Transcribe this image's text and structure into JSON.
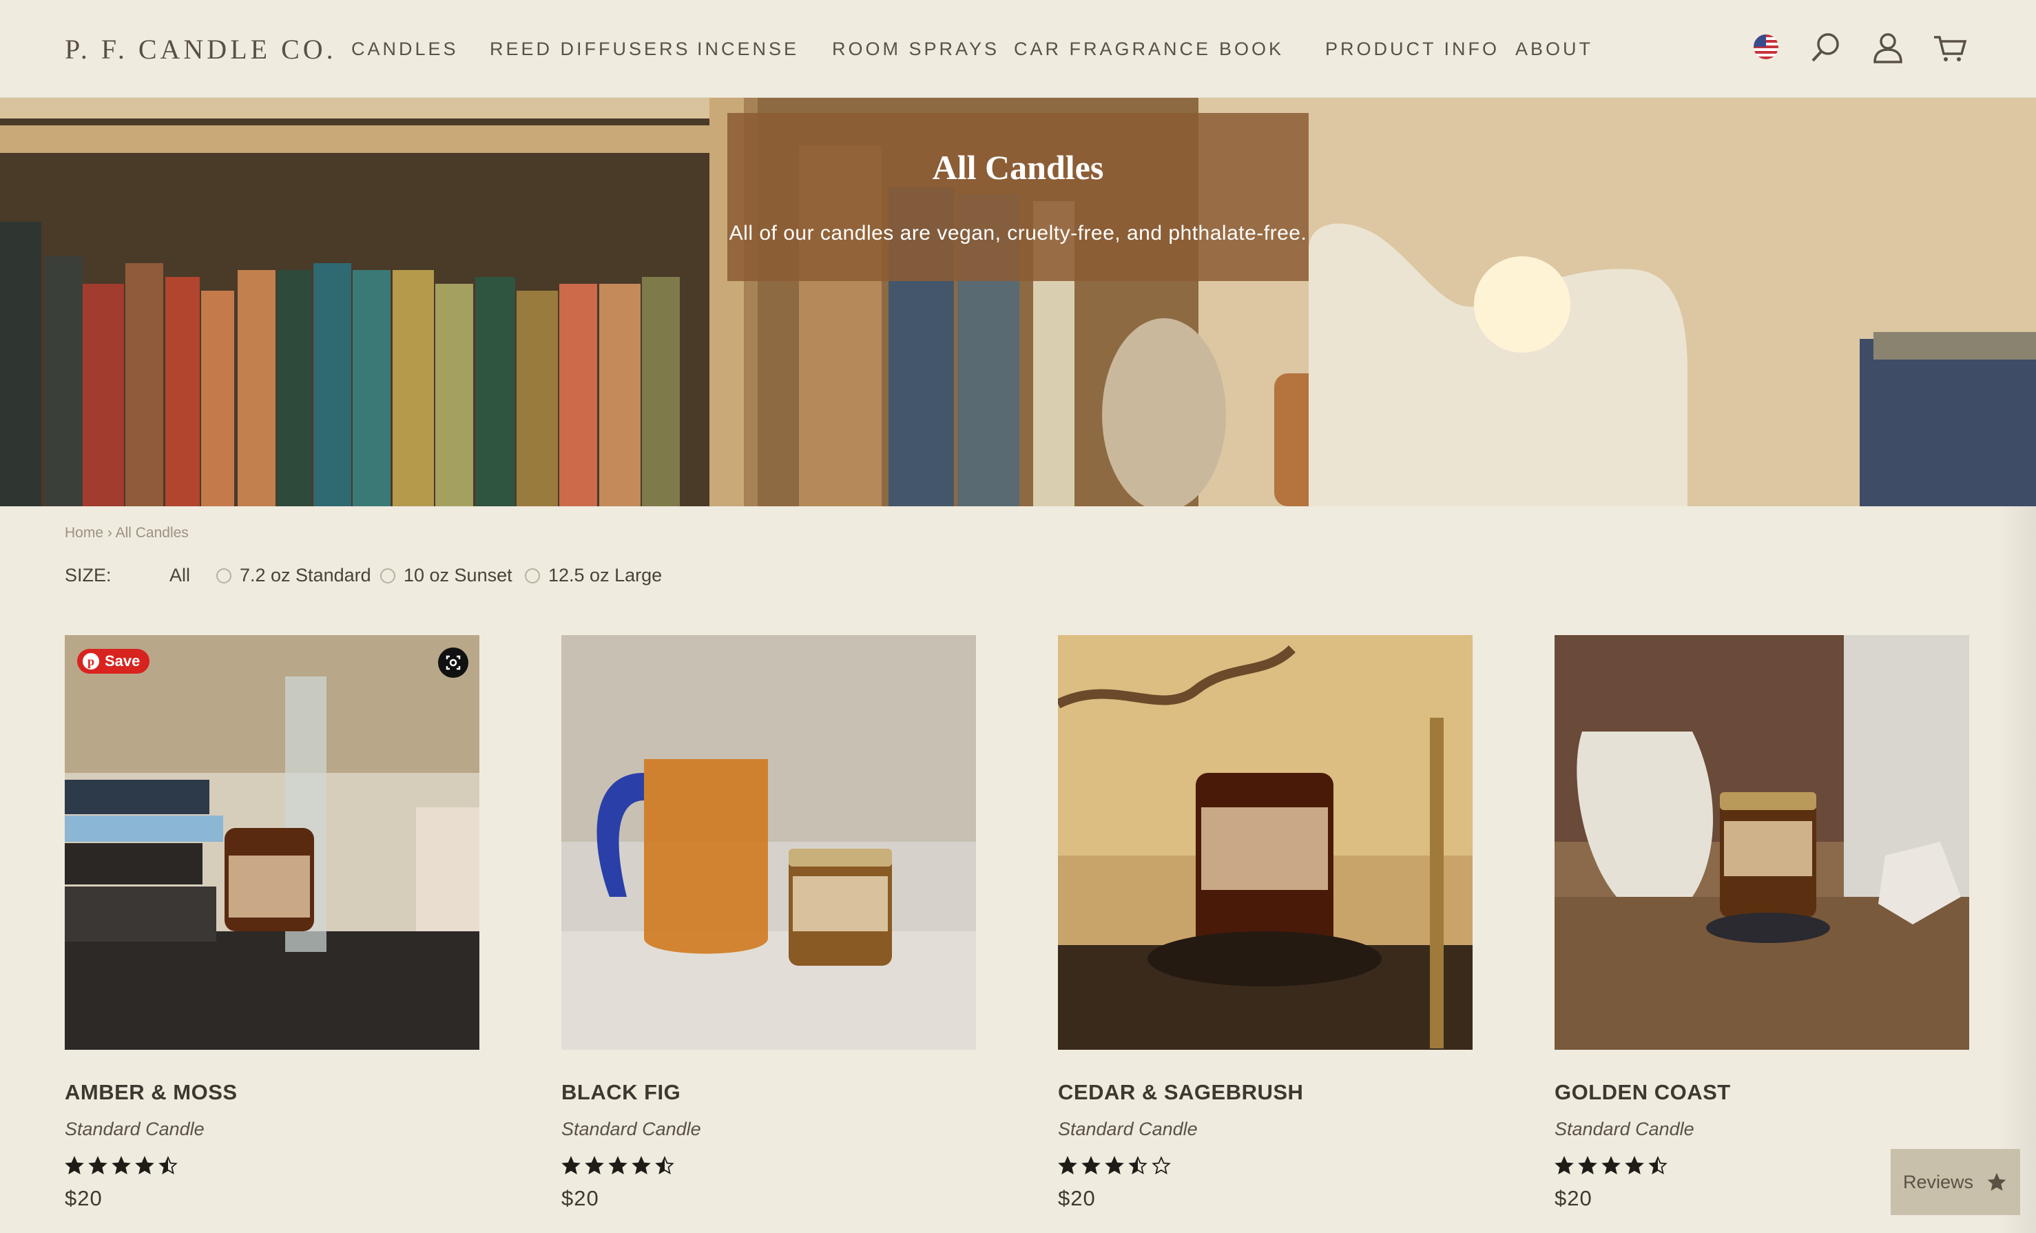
{
  "header": {
    "logo": "P. F. CANDLE CO.",
    "nav": [
      "CANDLES",
      "REED DIFFUSERS",
      "INCENSE",
      "ROOM SPRAYS",
      "CAR FRAGRANCE",
      "BOOK",
      "PRODUCT INFO",
      "ABOUT"
    ],
    "icons": [
      "us-flag-icon",
      "search-icon",
      "account-icon",
      "cart-icon"
    ]
  },
  "hero": {
    "title": "All Candles",
    "subtitle": "All of our candles are vegan, cruelty-free, and phthalate-free."
  },
  "breadcrumb": {
    "home": "Home",
    "separator": "›",
    "current": "All Candles"
  },
  "filters": {
    "label": "SIZE:",
    "options": [
      "All",
      "7.2 oz Standard",
      "10 oz Sunset",
      "12.5 oz Large"
    ],
    "selected": "All"
  },
  "products": [
    {
      "name": "AMBER & MOSS",
      "type": "Standard Candle",
      "rating": 4.5,
      "price": "$20"
    },
    {
      "name": "BLACK FIG",
      "type": "Standard Candle",
      "rating": 4.5,
      "price": "$20"
    },
    {
      "name": "CEDAR & SAGEBRUSH",
      "type": "Standard Candle",
      "rating": 3.5,
      "price": "$20"
    },
    {
      "name": "GOLDEN COAST",
      "type": "Standard Candle",
      "rating": 4.5,
      "price": "$20"
    }
  ],
  "pinterest": {
    "save_label": "Save"
  },
  "reviews_tab": {
    "label": "Reviews"
  },
  "colors": {
    "background": "#f0ebdf",
    "text": "#4a4238",
    "overlay": "#8c5c34",
    "pinterest": "#d8231f"
  }
}
